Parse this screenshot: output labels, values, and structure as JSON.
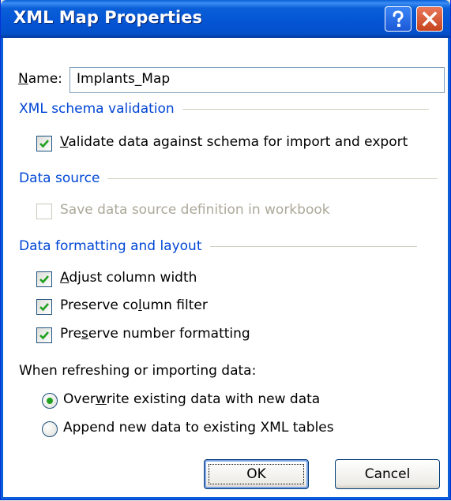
{
  "window": {
    "title": "XML Map Properties",
    "help_label": "?",
    "close_label": "✕"
  },
  "name_field": {
    "label_first": "N",
    "label_rest": "ame:",
    "value": "Implants_Map"
  },
  "schema_section": {
    "title": "XML schema validation",
    "validate": {
      "label_first": "V",
      "label_rest": "alidate data against schema for import and export",
      "checked": true
    }
  },
  "datasource_section": {
    "title": "Data source",
    "save_definition": {
      "label": "Save data source definition in workbook",
      "checked": false,
      "disabled": true
    }
  },
  "formatting_section": {
    "title": "Data formatting and layout",
    "adjust_width": {
      "label_first": "A",
      "label_rest": "djust column width",
      "checked": true
    },
    "preserve_filter": {
      "label_pre": "Preserve co",
      "label_u": "l",
      "label_rest": "umn filter",
      "checked": true
    },
    "preserve_number": {
      "label_pre": "Pre",
      "label_u": "s",
      "label_rest": "erve number formatting",
      "checked": true
    }
  },
  "refresh": {
    "prompt": "When refreshing or importing data:",
    "overwrite": {
      "label_pre": "Over",
      "label_u": "w",
      "label_rest": "rite existing data with new data",
      "selected": true
    },
    "append": {
      "label": "Append new data to existing XML tables",
      "selected": false
    }
  },
  "buttons": {
    "ok": "OK",
    "cancel": "Cancel"
  },
  "colors": {
    "titlebar": "#0a5fd8",
    "section_text": "#0046d5",
    "check": "#21a121",
    "disabled_text": "#aca899"
  }
}
